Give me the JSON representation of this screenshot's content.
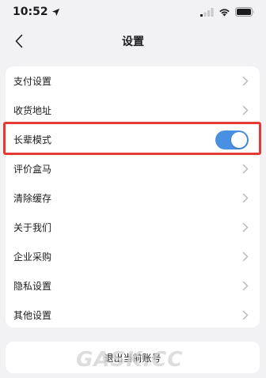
{
  "status_bar": {
    "time": "10:52",
    "icons": [
      "location-arrow-icon",
      "cellular-signal-icon",
      "wifi-icon",
      "battery-icon"
    ]
  },
  "nav": {
    "title": "设置",
    "back_icon": "chevron-left-icon"
  },
  "settings": {
    "items": [
      {
        "label": "支付设置",
        "control": "chevron"
      },
      {
        "label": "收货地址",
        "control": "chevron"
      },
      {
        "label": "长辈模式",
        "control": "toggle",
        "toggle_on": true
      },
      {
        "label": "评价盒马",
        "control": "chevron"
      },
      {
        "label": "清除缓存",
        "control": "chevron"
      },
      {
        "label": "关于我们",
        "control": "chevron"
      },
      {
        "label": "企业采购",
        "control": "chevron"
      },
      {
        "label": "隐私设置",
        "control": "chevron"
      },
      {
        "label": "其他设置",
        "control": "chevron"
      }
    ]
  },
  "logout": {
    "label": "退出当前账号"
  },
  "watermark": {
    "text": "GASK.CC"
  },
  "colors": {
    "background": "#f2f2f4",
    "card": "#ffffff",
    "toggle_on": "#4a90e2",
    "highlight": "#e53935",
    "chevron": "#b8b8bd"
  }
}
